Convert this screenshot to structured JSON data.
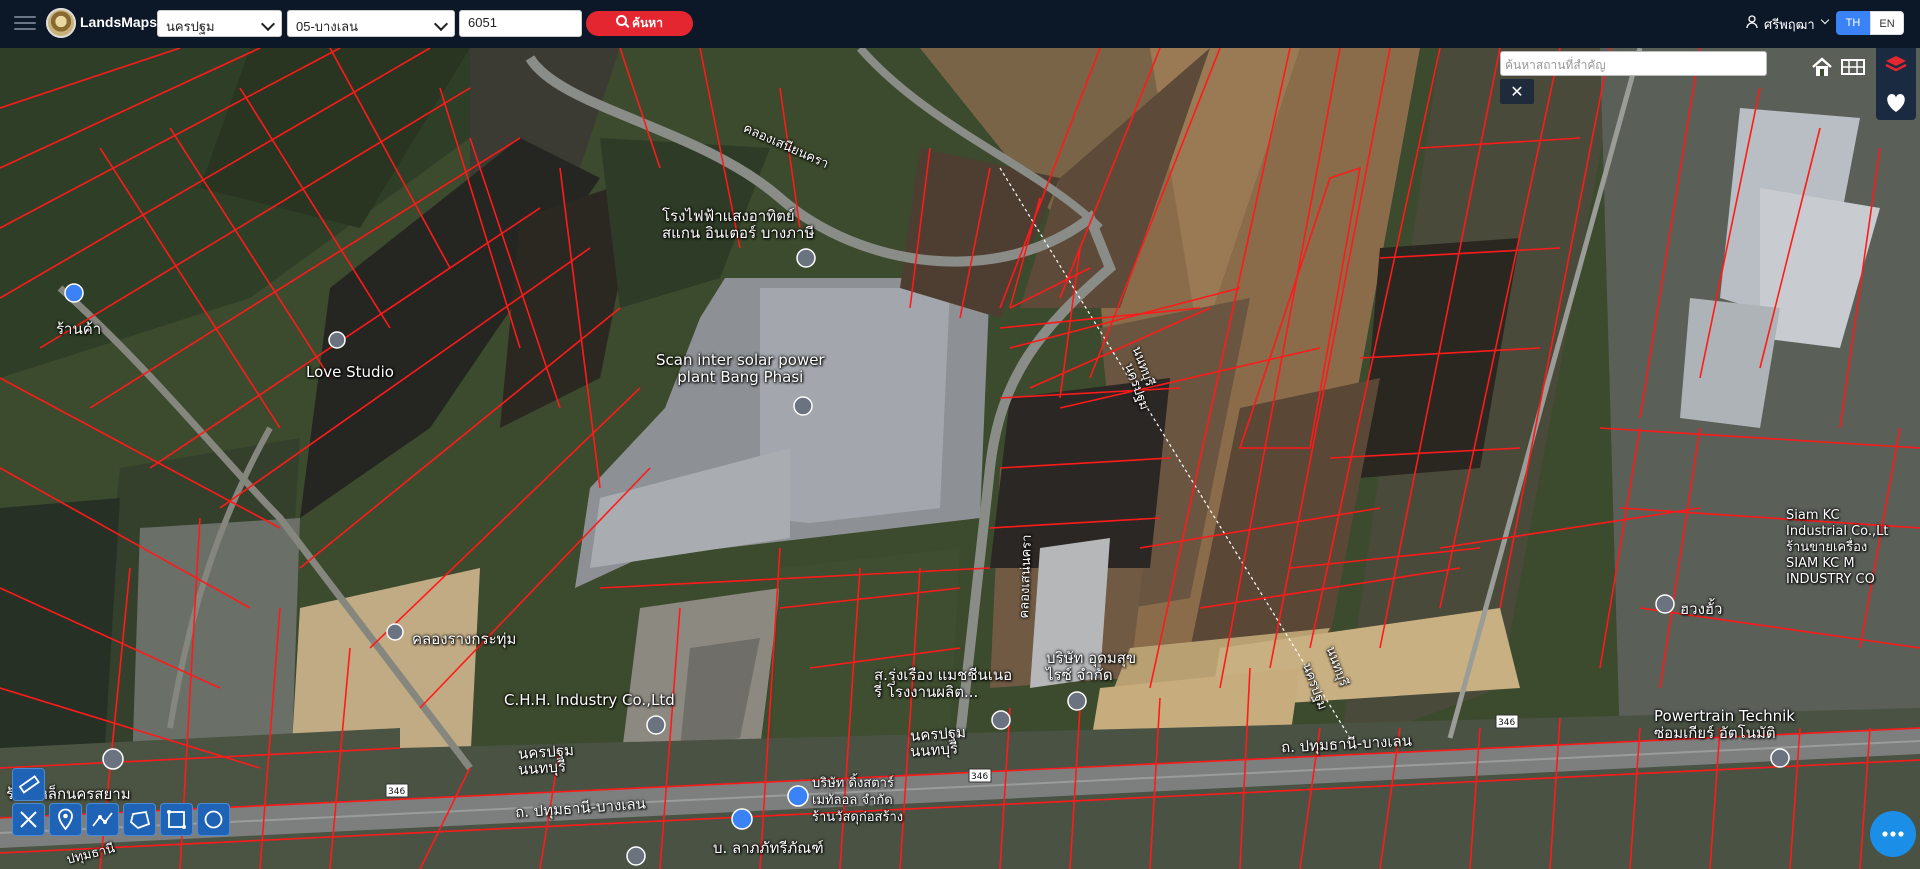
{
  "app": {
    "brand": "LandsMaps"
  },
  "search": {
    "province": "นครปฐม",
    "district": "05-บางเลน",
    "parcel_no": "6051",
    "submit_label": "ค้นหา",
    "place_placeholder": "ค้นหาสถานที่สำคัญ"
  },
  "user": {
    "name": "ศรีพฤฒา"
  },
  "language": {
    "th": "TH",
    "en": "EN"
  },
  "map_labels": {
    "plant_thai_1": "โรงไฟฟ้าแสงอาทิตย์",
    "plant_thai_2": "สแกน อินเตอร์ บางภาษี",
    "plant_en_1": "Scan inter solar power",
    "plant_en_2": "plant Bang Phasi",
    "love_studio": "Love Studio",
    "shop": "ร้านค้า",
    "canal_top": "คลองเสนียนครา",
    "canal_road": "คลองเสน่นครา",
    "canal_rang": "คลองรางกระทุ่ม",
    "chh": "C.H.H. Industry Co.,Ltd",
    "sr_thai_1": "ส.รุ่งเรือง แมชชีนเนอ",
    "sr_thai_2": "รี่ โรงงานผลิต...",
    "udom_1": "บริษัท อุดมสุข",
    "udom_2": "ไรซ์ จำกัด",
    "nonthaburi_1": "นนทบุรี",
    "nakhonpathom_1": "นครปฐม",
    "nonthaburi_2": "นนทบุรี",
    "nakhonpathom_2": "นครปฐม",
    "nakhonpathom_3": "นครปฐม",
    "nonthaburi_3": "นนทบุรี",
    "nakhonpathom_4": "นครปฐม",
    "nonthaburi_4": "นนทบุรี",
    "road_1": "ถ. ปทุมธานี-บางเลน",
    "road_2": "ถ. ปทุมธานี-บางเลน",
    "route_346": "346",
    "huangho": "ฮวงฮั้ว",
    "siam_1": "Siam KC",
    "siam_2": "Industrial Co.,Lt",
    "siam_3": "ร้านขายเครื่อง",
    "siam_4": "SIAM KC M",
    "siam_5": "INDUSTRY CO",
    "powertrain_1": "Powertrain Technik",
    "powertrain_2": "ซ่อมเกียร์ อัตโนมัติ",
    "ding_1": "บริษัท ดิ้งสตาร์",
    "ding_2": "เมทัลอล จำกัด",
    "ding_3": "ร้านวัสดุก่อสร้าง",
    "lamphu": "บ. ลาภภัทรีภัณฑ์",
    "bottom_left": "ร้านเหล็กนครสยาม",
    "bottom_left_2": "ปทุมธานี"
  },
  "colors": {
    "topbar": "#0c1828",
    "parcel_line": "#ff1a1a",
    "search_btn": "#e3262f",
    "lang_active": "#3b82f6"
  },
  "icons": [
    "menu-icon",
    "search-icon",
    "user-icon",
    "home-icon",
    "grid-icon",
    "layers-icon",
    "heart-icon",
    "close-icon",
    "ruler-icon",
    "location-pin-icon",
    "line-measure-icon",
    "polygon-icon",
    "rectangle-icon",
    "circle-icon",
    "chat-icon"
  ]
}
